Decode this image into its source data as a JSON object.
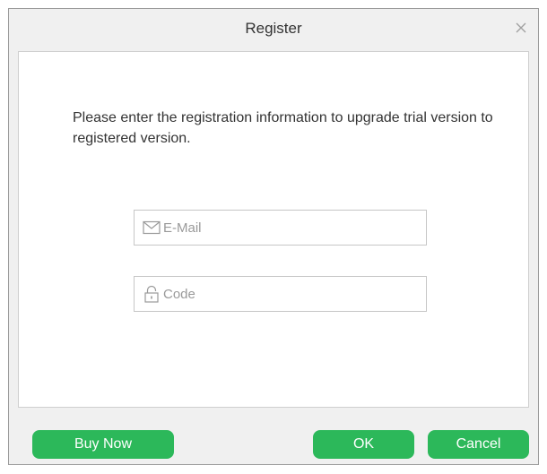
{
  "window": {
    "title": "Register",
    "close_icon": "close-icon"
  },
  "content": {
    "message": "Please enter the registration information to upgrade trial version to registered version."
  },
  "form": {
    "email": {
      "icon": "envelope-icon",
      "placeholder": "E-Mail",
      "value": ""
    },
    "code": {
      "icon": "lock-icon",
      "placeholder": "Code",
      "value": ""
    }
  },
  "buttons": {
    "buy_now": "Buy Now",
    "ok": "OK",
    "cancel": "Cancel"
  },
  "colors": {
    "accent": "#2cb85a",
    "dialog_bg": "#f0f0f0",
    "content_bg": "#ffffff"
  }
}
